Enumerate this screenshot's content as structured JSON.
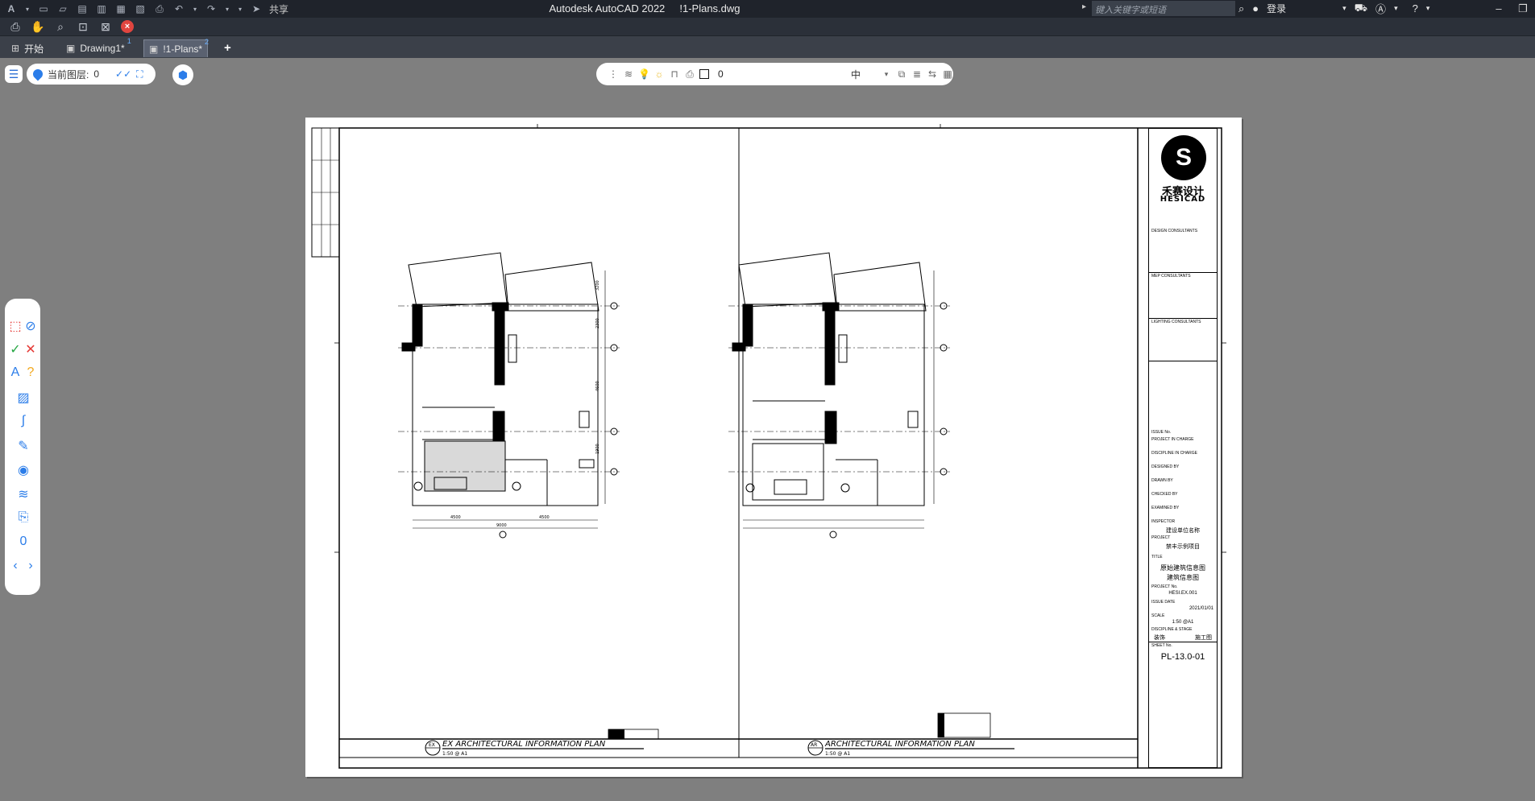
{
  "app": {
    "title": "Autodesk AutoCAD 2022",
    "file": "!1-Plans.dwg",
    "search_placeholder": "键入关键字或短语",
    "share_label": "共享",
    "login_label": "登录"
  },
  "tabs": [
    {
      "label": "开始"
    },
    {
      "label": "Drawing1*"
    },
    {
      "label": "!1-Plans*"
    }
  ],
  "viewport": {
    "layer_label": "当前图层:",
    "layer_value": "0",
    "layer_name": "0",
    "middle_char": "中"
  },
  "sheet": {
    "brand_cn": "禾赛设计",
    "brand_en": "HESICAD",
    "consultants": [
      "DESIGN CONSULTANTS",
      "MEP CONSULTANTS",
      "LIGHTING CONSULTANTS"
    ],
    "fields": [
      {
        "label": "ISSUE No."
      },
      {
        "label": "PROJECT IN CHARGE"
      },
      {
        "label": "DISCIPLINE IN CHARGE"
      },
      {
        "label": "DESIGNED BY"
      },
      {
        "label": "DRAWN BY"
      },
      {
        "label": "CHECKED BY"
      },
      {
        "label": "EXAMINED BY"
      },
      {
        "label": "INSPECTOR"
      }
    ],
    "project_cn": "建设单位名称",
    "project_label": "PROJECT",
    "project_value": "禁丰示例项目",
    "title_label": "TITLE",
    "title_lines": [
      "原始建筑信息图",
      "建筑信息图"
    ],
    "project_no_label": "PROJECT No.",
    "project_no": "HESI.EX.001",
    "issue_date_label": "ISSUE DATE",
    "issue_date": "2021/01/01",
    "scale_label": "SCALE",
    "scale": "1:50 @A1",
    "discipline_label": "DISCIPLINE & STAGE",
    "discipline_left": "装饰",
    "discipline_right": "施工图",
    "sheet_no_label": "SHEET No.",
    "sheet_no": "PL-13.0-01",
    "plans": [
      {
        "code": "EX",
        "title": "EX ARCHITECTURAL INFORMATION PLAN",
        "scale": "1:50 @ A1"
      },
      {
        "code": "AR",
        "title": "ARCHITECTURAL INFORMATION PLAN",
        "scale": "1:50 @ A1"
      }
    ],
    "dims": {
      "a": "3200",
      "b": "4600",
      "c": "2300",
      "d": "1900",
      "w1": "4500",
      "w2": "4500",
      "total": "9000"
    }
  }
}
